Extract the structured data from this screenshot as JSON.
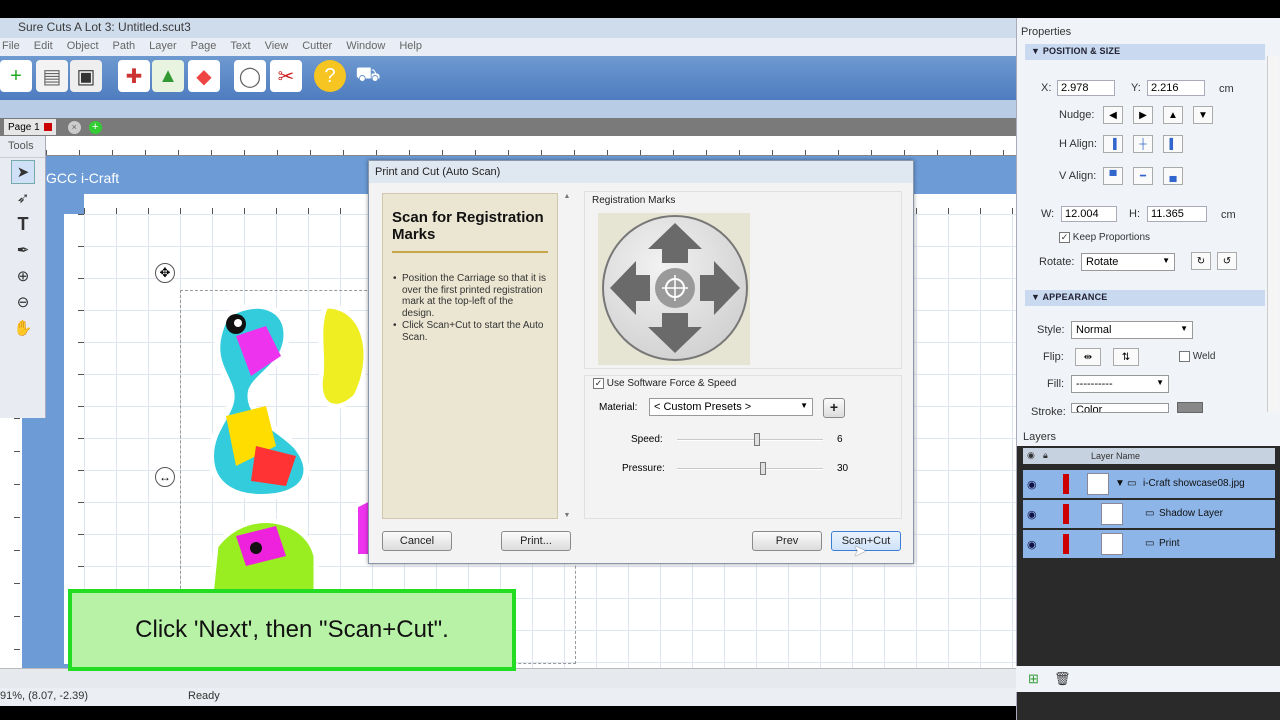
{
  "app": {
    "title": "Sure Cuts A Lot 3: Untitled.scut3",
    "menu": [
      "File",
      "Edit",
      "Object",
      "Path",
      "Layer",
      "Page",
      "Text",
      "View",
      "Cutter",
      "Window",
      "Help"
    ]
  },
  "page_tab": {
    "label": "Page 1"
  },
  "tools": {
    "label": "Tools"
  },
  "mat": {
    "label": "GCC i-Craft"
  },
  "status": {
    "coords": "91%, (8.07, -2.39)",
    "state": "Ready"
  },
  "dialog": {
    "title": "Print and Cut (Auto Scan)",
    "heading": "Scan for Registration Marks",
    "instructions": [
      "Position the Carriage so that it is over the first printed registration mark at the top-left of the design.",
      "Click Scan+Cut to start the Auto Scan."
    ],
    "reg_label": "Registration Marks",
    "use_force_label": "Use Software Force  & Speed",
    "use_force_checked": true,
    "material_label": "Material:",
    "material_value": "< Custom Presets >",
    "plus_label": "+",
    "speed_label": "Speed:",
    "speed_value": "6",
    "speed_level": 0.55,
    "pressure_label": "Pressure:",
    "pressure_value": "30",
    "pressure_level": 0.59,
    "buttons": {
      "cancel": "Cancel",
      "print": "Print...",
      "prev": "Prev",
      "scancut": "Scan+Cut"
    }
  },
  "properties": {
    "title": "Properties",
    "pos_section": "POSITION & SIZE",
    "x_label": "X:",
    "x_value": "2.978",
    "y_label": "Y:",
    "y_value": "2.216",
    "unit": "cm",
    "nudge_label": "Nudge:",
    "halign_label": "H Align:",
    "valign_label": "V Align:",
    "w_label": "W:",
    "w_value": "12.004",
    "h_label": "H:",
    "h_value": "11.365",
    "keep_label": "Keep Proportions",
    "rotate_label": "Rotate:",
    "rotate_value": "Rotate",
    "app_section": "APPEARANCE",
    "style_label": "Style:",
    "style_value": "Normal",
    "flip_label": "Flip:",
    "weld_label": "Weld",
    "fill_label": "Fill:",
    "fill_value": "----------",
    "stroke_label": "Stroke:",
    "stroke_value": "Color"
  },
  "layers": {
    "title": "Layers",
    "col_name": "Layer Name",
    "rows": [
      {
        "name": "i-Craft showcase08.jpg"
      },
      {
        "name": "Shadow Layer"
      },
      {
        "name": "Print"
      }
    ]
  },
  "caption": "Click 'Next', then \"Scan+Cut\"."
}
